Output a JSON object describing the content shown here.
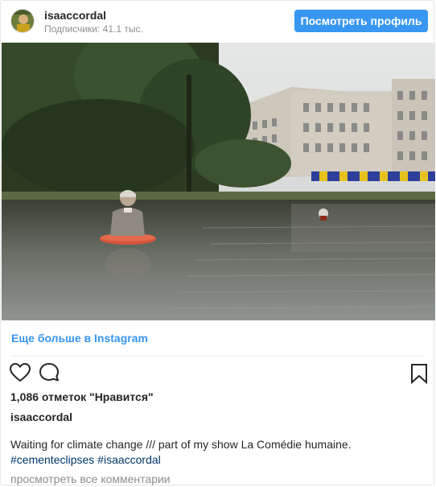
{
  "header": {
    "username": "isaaccordal",
    "followers": "Подписчики: 41.1 тыс.",
    "view_profile_label": "Посмотреть профиль"
  },
  "photo": {
    "description_icon": "photo-sculpture-in-lake"
  },
  "more_link": "Еще больше в Instagram",
  "actions": {
    "like_icon": "heart-outline-icon",
    "comment_icon": "speech-bubble-icon",
    "save_icon": "bookmark-icon"
  },
  "likes": "1,086 отметок \"Нравится\"",
  "caption": {
    "username": "isaaccordal",
    "text": "Waiting for climate change /// part of my show La Comédie humaine.",
    "hashtags": [
      "#cementeclipses",
      "#isaaccordal"
    ]
  },
  "view_comments": "просмотреть все комментарии",
  "colors": {
    "accent": "#3897f0",
    "hashtag": "#003569",
    "muted": "#8e8e8e",
    "text": "#262626"
  }
}
